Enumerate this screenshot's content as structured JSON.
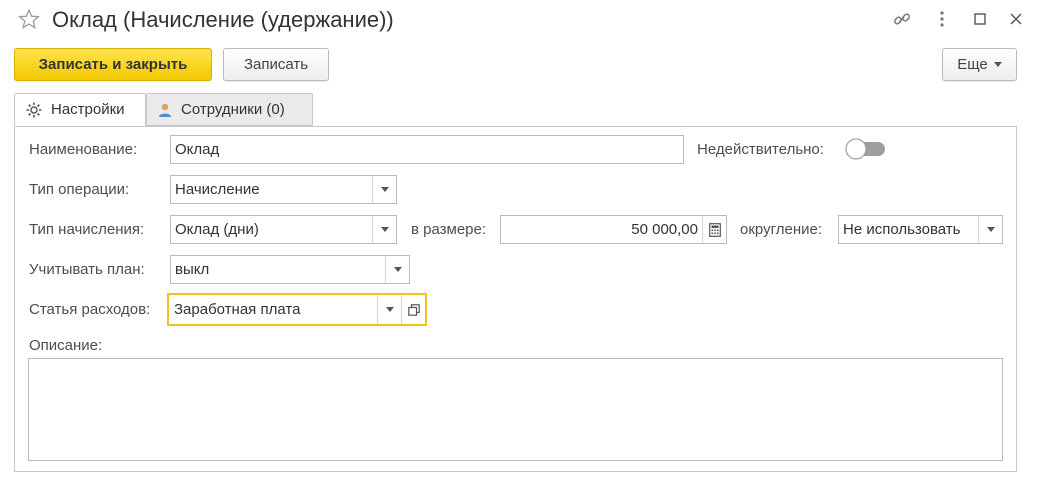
{
  "window": {
    "title": "Оклад (Начисление (удержание))",
    "icons": [
      "star-icon",
      "link-icon",
      "more-icon",
      "maximize-icon",
      "close-icon"
    ]
  },
  "toolbar": {
    "save_close_label": "Записать и закрыть",
    "save_label": "Записать",
    "more_label": "Еще"
  },
  "tabs": [
    {
      "label": "Настройки",
      "icon": "gear-icon",
      "active": true
    },
    {
      "label": "Сотрудники (0)",
      "icon": "user-icon",
      "active": false
    }
  ],
  "form": {
    "name_label": "Наименование:",
    "name_value": "Оклад",
    "invalid_label": "Недействительно:",
    "invalid_value": false,
    "operation_label": "Тип операции:",
    "operation_value": "Начисление",
    "accrual_type_label": "Тип начисления:",
    "accrual_type_value": "Оклад (дни)",
    "amount_label": "в размере:",
    "amount_value": "50 000,00",
    "rounding_label": "округление:",
    "rounding_value": "Не использовать",
    "plan_label": "Учитывать план:",
    "plan_value": "выкл",
    "expense_label": "Статья расходов:",
    "expense_value": "Заработная плата",
    "description_label": "Описание:",
    "description_value": ""
  },
  "colors": {
    "primary_button": "#f2c800",
    "focus_border": "#f2c11e",
    "border": "#b9b9b9"
  }
}
